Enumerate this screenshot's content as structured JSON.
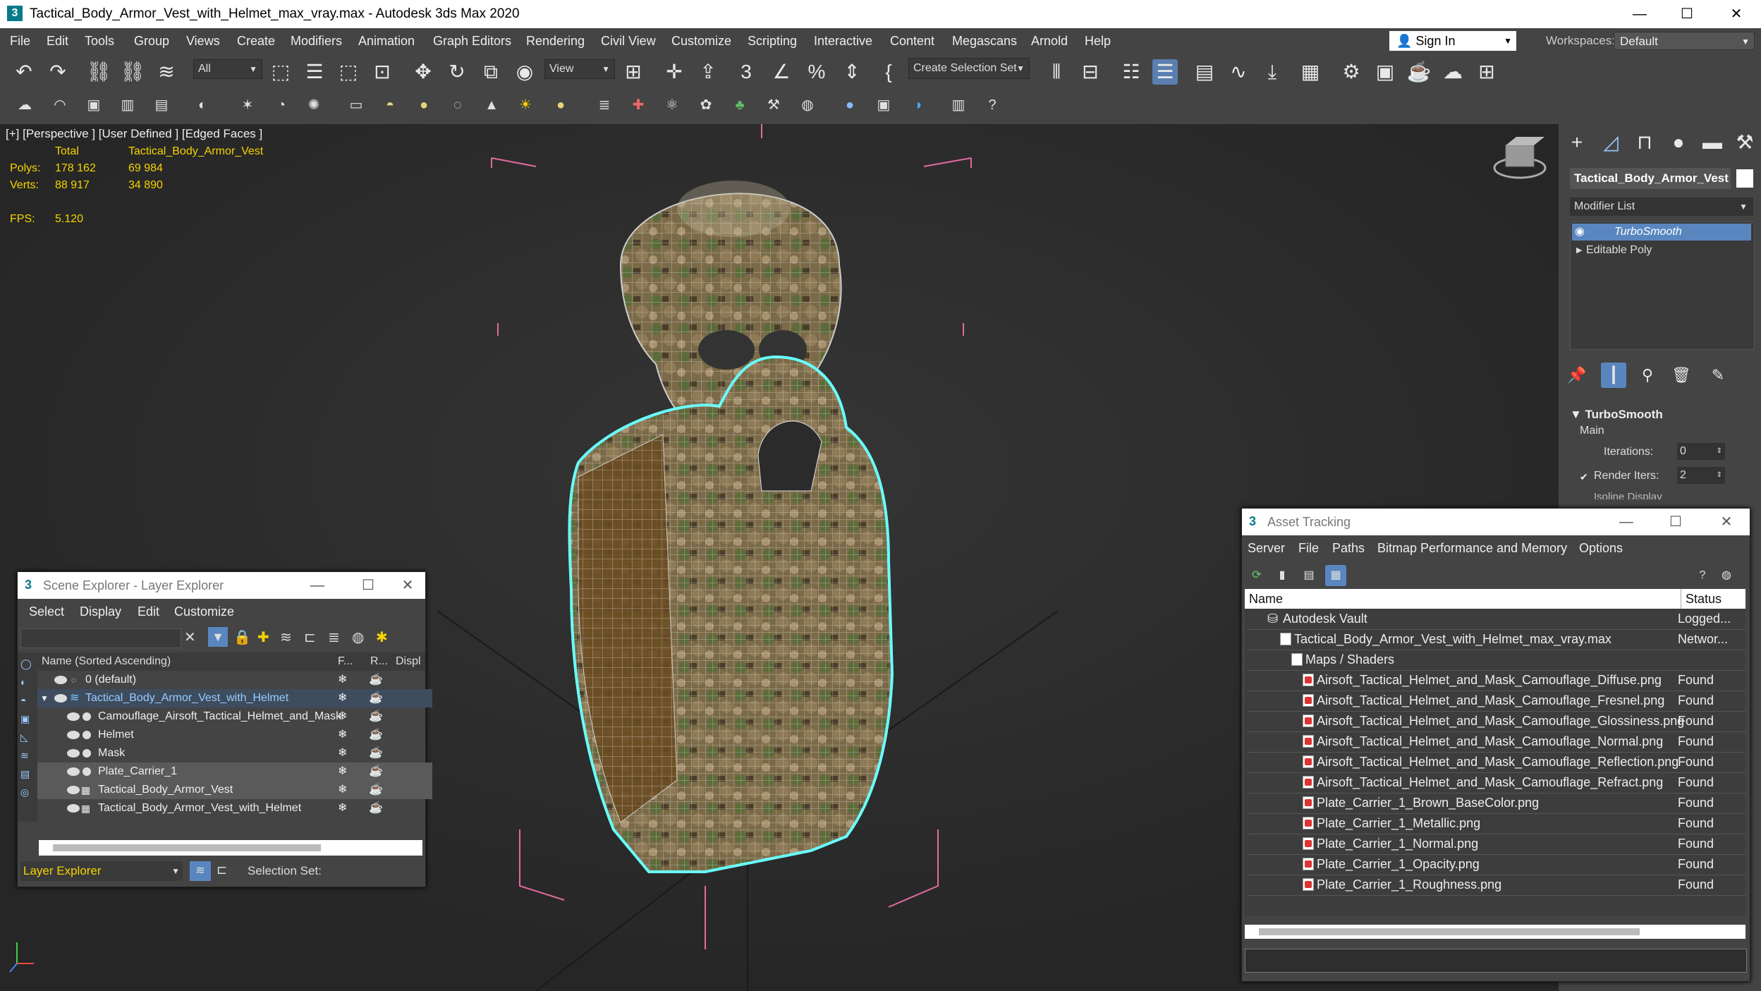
{
  "window": {
    "title": "Tactical_Body_Armor_Vest_with_Helmet_max_vray.max - Autodesk 3ds Max 2020",
    "logo": "3",
    "minimize": "—",
    "maximize": "☐",
    "close": "✕"
  },
  "menu": {
    "items": [
      "File",
      "Edit",
      "Tools",
      "Group",
      "Views",
      "Create",
      "Modifiers",
      "Animation",
      "Graph Editors",
      "Rendering",
      "Civil View",
      "Customize",
      "Scripting",
      "Interactive",
      "Content",
      "Megascans",
      "Arnold",
      "Help"
    ],
    "sign_in": "Sign In",
    "workspaces_label": "Workspaces:",
    "workspaces_value": "Default"
  },
  "toolbar": {
    "filter": "All",
    "ref_coord": "View",
    "selection_set": "Create Selection Set"
  },
  "viewport": {
    "label": "[+] [Perspective ] [User Defined ] [Edged Faces ]",
    "stats": {
      "total_header": "Total",
      "object_header": "Tactical_Body_Armor_Vest",
      "polys_label": "Polys:",
      "polys_total": "178 162",
      "polys_obj": "69 984",
      "verts_label": "Verts:",
      "verts_total": "88 917",
      "verts_obj": "34 890",
      "fps_label": "FPS:",
      "fps_value": "5.120"
    }
  },
  "command_panel": {
    "object_name": "Tactical_Body_Armor_Vest",
    "modifier_list": "Modifier List",
    "stack": [
      "TurboSmooth",
      "Editable Poly"
    ],
    "rollout_title": "TurboSmooth",
    "main_label": "Main",
    "iterations_label": "Iterations:",
    "iterations_value": "0",
    "render_iters_label": "Render Iters:",
    "render_iters_value": "2",
    "isoline_label": "Isoline Display"
  },
  "scene_explorer": {
    "title": "Scene Explorer - Layer Explorer",
    "menu": [
      "Select",
      "Display",
      "Edit",
      "Customize"
    ],
    "col_name": "Name (Sorted Ascending)",
    "col_f": "F...",
    "col_r": "R...",
    "col_disp": "Displ",
    "rows": [
      {
        "name": "0 (default)",
        "level": 1
      },
      {
        "name": "Tactical_Body_Armor_Vest_with_Helmet",
        "level": 1
      },
      {
        "name": "Camouflage_Airsoft_Tactical_Helmet_and_Mask",
        "level": 2
      },
      {
        "name": "Helmet",
        "level": 2
      },
      {
        "name": "Mask",
        "level": 2
      },
      {
        "name": "Plate_Carrier_1",
        "level": 2
      },
      {
        "name": "Tactical_Body_Armor_Vest",
        "level": 2
      },
      {
        "name": "Tactical_Body_Armor_Vest_with_Helmet",
        "level": 2
      }
    ],
    "footer_explorer": "Layer Explorer",
    "footer_selset": "Selection Set:"
  },
  "asset_tracking": {
    "title": "Asset Tracking",
    "menu": [
      "Server",
      "File",
      "Paths",
      "Bitmap Performance and Memory",
      "Options"
    ],
    "col_name": "Name",
    "col_status": "Status",
    "rows": [
      {
        "name": "Autodesk Vault",
        "status": "Logged...",
        "indent": 1
      },
      {
        "name": "Tactical_Body_Armor_Vest_with_Helmet_max_vray.max",
        "status": "Networ...",
        "indent": 2
      },
      {
        "name": "Maps / Shaders",
        "status": "",
        "indent": 3
      },
      {
        "name": "Airsoft_Tactical_Helmet_and_Mask_Camouflage_Diffuse.png",
        "status": "Found",
        "indent": 4
      },
      {
        "name": "Airsoft_Tactical_Helmet_and_Mask_Camouflage_Fresnel.png",
        "status": "Found",
        "indent": 4
      },
      {
        "name": "Airsoft_Tactical_Helmet_and_Mask_Camouflage_Glossiness.png",
        "status": "Found",
        "indent": 4
      },
      {
        "name": "Airsoft_Tactical_Helmet_and_Mask_Camouflage_Normal.png",
        "status": "Found",
        "indent": 4
      },
      {
        "name": "Airsoft_Tactical_Helmet_and_Mask_Camouflage_Reflection.png",
        "status": "Found",
        "indent": 4
      },
      {
        "name": "Airsoft_Tactical_Helmet_and_Mask_Camouflage_Refract.png",
        "status": "Found",
        "indent": 4
      },
      {
        "name": "Plate_Carrier_1_Brown_BaseColor.png",
        "status": "Found",
        "indent": 4
      },
      {
        "name": "Plate_Carrier_1_Metallic.png",
        "status": "Found",
        "indent": 4
      },
      {
        "name": "Plate_Carrier_1_Normal.png",
        "status": "Found",
        "indent": 4
      },
      {
        "name": "Plate_Carrier_1_Opacity.png",
        "status": "Found",
        "indent": 4
      },
      {
        "name": "Plate_Carrier_1_Roughness.png",
        "status": "Found",
        "indent": 4
      }
    ]
  },
  "colors": {
    "accent": "#4a90d9",
    "selection_cyan": "#6ff",
    "stat_yellow": "#f5d400"
  }
}
